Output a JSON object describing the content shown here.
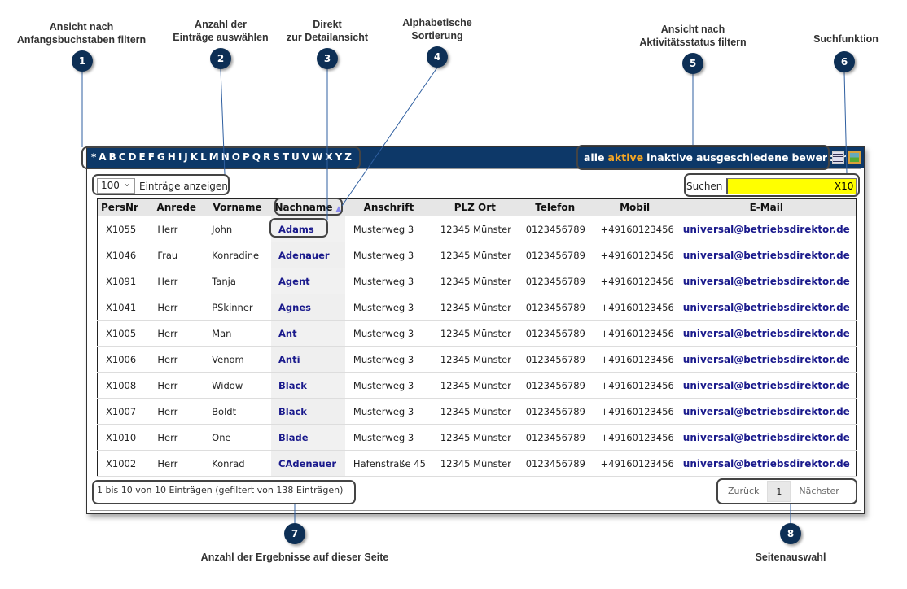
{
  "letters": [
    "*",
    "A",
    "B",
    "C",
    "D",
    "E",
    "F",
    "G",
    "H",
    "I",
    "J",
    "K",
    "L",
    "M",
    "N",
    "O",
    "P",
    "Q",
    "R",
    "S",
    "T",
    "U",
    "V",
    "W",
    "X",
    "Y",
    "Z"
  ],
  "status_filters": [
    {
      "label": "alle",
      "active": false
    },
    {
      "label": "aktive",
      "active": true
    },
    {
      "label": "inaktive",
      "active": false
    },
    {
      "label": "ausgeschiedene",
      "active": false
    },
    {
      "label": "bewerber",
      "active": false
    }
  ],
  "icons": [
    "list-view-icon",
    "image-view-icon"
  ],
  "accent_color": "#f5a623",
  "header_color": "#0d3868",
  "length": {
    "value": "100",
    "label": "Einträge anzeigen"
  },
  "search": {
    "label": "Suchen",
    "value": "X10"
  },
  "columns": [
    "PersNr",
    "Anrede",
    "Vorname",
    "Nachname",
    "Anschrift",
    "PLZ Ort",
    "Telefon",
    "Mobil",
    "E-Mail"
  ],
  "sorted_column": "Nachname",
  "rows": [
    [
      "X1055",
      "Herr",
      "John",
      "Adams",
      "Musterweg 3",
      "12345 Münster",
      "0123456789",
      "+49160123456",
      "universal@betriebsdirektor.de"
    ],
    [
      "X1046",
      "Frau",
      "Konradine",
      "Adenauer",
      "Musterweg 3",
      "12345 Münster",
      "0123456789",
      "+49160123456",
      "universal@betriebsdirektor.de"
    ],
    [
      "X1091",
      "Herr",
      "Tanja",
      "Agent",
      "Musterweg 3",
      "12345 Münster",
      "0123456789",
      "+49160123456",
      "universal@betriebsdirektor.de"
    ],
    [
      "X1041",
      "Herr",
      "PSkinner",
      "Agnes",
      "Musterweg 3",
      "12345 Münster",
      "0123456789",
      "+49160123456",
      "universal@betriebsdirektor.de"
    ],
    [
      "X1005",
      "Herr",
      "Man",
      "Ant",
      "Musterweg 3",
      "12345 Münster",
      "0123456789",
      "+49160123456",
      "universal@betriebsdirektor.de"
    ],
    [
      "X1006",
      "Herr",
      "Venom",
      "Anti",
      "Musterweg 3",
      "12345 Münster",
      "0123456789",
      "+49160123456",
      "universal@betriebsdirektor.de"
    ],
    [
      "X1008",
      "Herr",
      "Widow",
      "Black",
      "Musterweg 3",
      "12345 Münster",
      "0123456789",
      "+49160123456",
      "universal@betriebsdirektor.de"
    ],
    [
      "X1007",
      "Herr",
      "Boldt",
      "Black",
      "Musterweg 3",
      "12345 Münster",
      "0123456789",
      "+49160123456",
      "universal@betriebsdirektor.de"
    ],
    [
      "X1010",
      "Herr",
      "One",
      "Blade",
      "Musterweg 3",
      "12345 Münster",
      "0123456789",
      "+49160123456",
      "universal@betriebsdirektor.de"
    ],
    [
      "X1002",
      "Herr",
      "Konrad",
      "CAdenauer",
      "Hafenstraße 45",
      "12345 Münster",
      "0123456789",
      "+49160123456",
      "universal@betriebsdirektor.de"
    ]
  ],
  "info": "1 bis 10 von 10 Einträgen (gefiltert von 138 Einträgen)",
  "pager": {
    "prev": "Zurück",
    "current": "1",
    "next": "Nächster"
  },
  "callouts": [
    {
      "n": "1",
      "label": [
        "Ansicht nach",
        "Anfangsbuchstaben filtern"
      ]
    },
    {
      "n": "2",
      "label": [
        "Anzahl der",
        "Einträge auswählen"
      ]
    },
    {
      "n": "3",
      "label": [
        "Direkt",
        "zur Detailansicht"
      ]
    },
    {
      "n": "4",
      "label": [
        "Alphabetische",
        "Sortierung"
      ]
    },
    {
      "n": "5",
      "label": [
        "Ansicht nach",
        "Aktivitätsstatus filtern"
      ]
    },
    {
      "n": "6",
      "label": [
        "Suchfunktion"
      ]
    },
    {
      "n": "7",
      "label": [
        "Anzahl der Ergebnisse auf dieser Seite"
      ]
    },
    {
      "n": "8",
      "label": [
        "Seitenauswahl"
      ]
    }
  ]
}
